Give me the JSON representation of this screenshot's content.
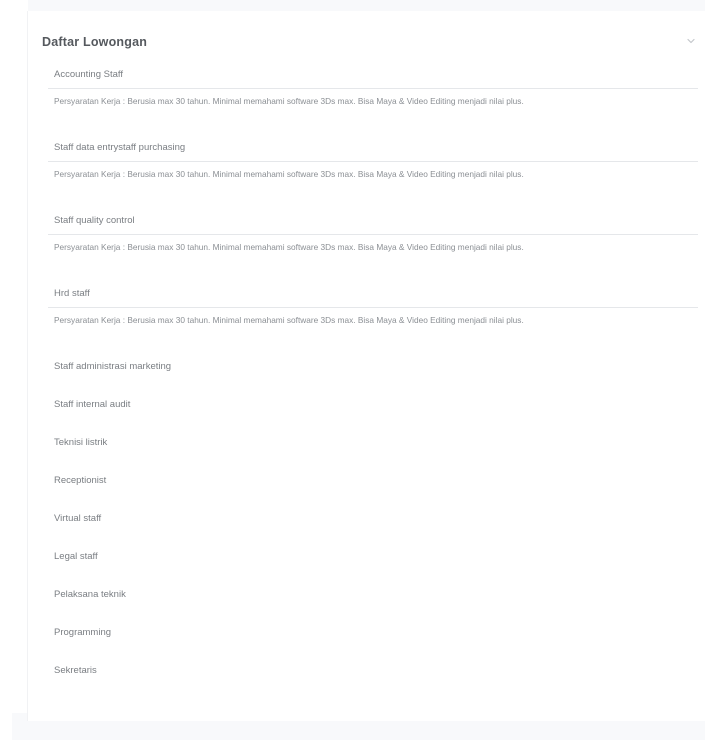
{
  "header": {
    "title": "Daftar Lowongan"
  },
  "expanded_jobs": [
    {
      "title": "Accounting Staff",
      "description": "Persyaratan Kerja : Berusia max 30 tahun. Minimal memahami software 3Ds max. Bisa Maya & Video Editing menjadi nilai plus."
    },
    {
      "title": "Staff data entrystaff purchasing",
      "description": "Persyaratan Kerja : Berusia max 30 tahun. Minimal memahami software 3Ds max. Bisa Maya & Video Editing menjadi nilai plus."
    },
    {
      "title": "Staff quality control",
      "description": "Persyaratan Kerja : Berusia max 30 tahun. Minimal memahami software 3Ds max. Bisa Maya & Video Editing menjadi nilai plus."
    },
    {
      "title": "Hrd staff",
      "description": "Persyaratan Kerja : Berusia max 30 tahun. Minimal memahami software 3Ds max. Bisa Maya & Video Editing menjadi nilai plus."
    }
  ],
  "collapsed_jobs": [
    "Staff administrasi marketing",
    "Staff internal audit",
    "Teknisi listrik",
    "Receptionist",
    "Virtual staff",
    "Legal staff",
    "Pelaksana teknik",
    "Programming",
    "Sekretaris"
  ],
  "icons": {
    "chevron": "chevron-down-icon"
  },
  "colors": {
    "text": "#7a7e83",
    "heading": "#55595e",
    "divider": "#e5e7ea",
    "background_strip": "#f8f9fb"
  }
}
